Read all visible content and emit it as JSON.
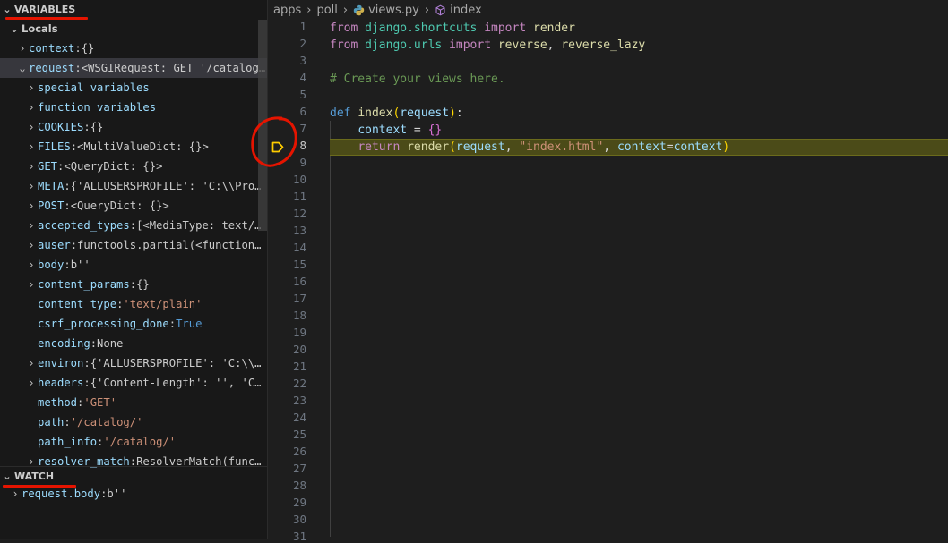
{
  "variables": {
    "title": "VARIABLES",
    "locals_label": "Locals",
    "items": [
      {
        "key": "context",
        "sep": ": ",
        "value": "{}",
        "vclass": "v",
        "kclass": "k2",
        "indent": 1,
        "chevron": "›"
      },
      {
        "key": "request",
        "sep": ": ",
        "value": "<WSGIRequest: GET '/catalog/'>",
        "vclass": "v",
        "kclass": "k2",
        "indent": 1,
        "chevron": "⌄",
        "selected": true
      },
      {
        "key": "special variables",
        "sep": "",
        "value": "",
        "vclass": "v",
        "kclass": "k2",
        "indent": 2,
        "chevron": "›"
      },
      {
        "key": "function variables",
        "sep": "",
        "value": "",
        "vclass": "v",
        "kclass": "k2",
        "indent": 2,
        "chevron": "›"
      },
      {
        "key": "COOKIES",
        "sep": ": ",
        "value": "{}",
        "vclass": "v",
        "kclass": "k2",
        "indent": 2,
        "chevron": "›"
      },
      {
        "key": "FILES",
        "sep": ": ",
        "value": "<MultiValueDict: {}>",
        "vclass": "v",
        "kclass": "k2",
        "indent": 2,
        "chevron": "›"
      },
      {
        "key": "GET",
        "sep": ": ",
        "value": "<QueryDict: {}>",
        "vclass": "v",
        "kclass": "k2",
        "indent": 2,
        "chevron": "›"
      },
      {
        "key": "META",
        "sep": ": ",
        "value": "{'ALLUSERSPROFILE': 'C:\\\\ProgramData'}",
        "vclass": "v",
        "kclass": "k2",
        "indent": 2,
        "chevron": "›"
      },
      {
        "key": "POST",
        "sep": ": ",
        "value": "<QueryDict: {}>",
        "vclass": "v",
        "kclass": "k2",
        "indent": 2,
        "chevron": "›"
      },
      {
        "key": "accepted_types",
        "sep": ": ",
        "value": "[<MediaType: text/plain>]",
        "vclass": "v",
        "kclass": "k2",
        "indent": 2,
        "chevron": "›"
      },
      {
        "key": "auser",
        "sep": ": ",
        "value": "functools.partial(<function auser>)",
        "vclass": "v",
        "kclass": "k2",
        "indent": 2,
        "chevron": "›"
      },
      {
        "key": "body",
        "sep": ": ",
        "value": "b''",
        "vclass": "v",
        "kclass": "k2",
        "indent": 2,
        "chevron": "›"
      },
      {
        "key": "content_params",
        "sep": ": ",
        "value": "{}",
        "vclass": "v",
        "kclass": "k2",
        "indent": 2,
        "chevron": "›"
      },
      {
        "key": "content_type",
        "sep": ": ",
        "value": "'text/plain'",
        "vclass": "vs",
        "kclass": "k2",
        "indent": 2,
        "chevron": ""
      },
      {
        "key": "csrf_processing_done",
        "sep": ": ",
        "value": "True",
        "vclass": "vb",
        "kclass": "k2",
        "indent": 2,
        "chevron": ""
      },
      {
        "key": "encoding",
        "sep": ": ",
        "value": "None",
        "vclass": "v",
        "kclass": "k2",
        "indent": 2,
        "chevron": ""
      },
      {
        "key": "environ",
        "sep": ": ",
        "value": "{'ALLUSERSPROFILE': 'C:\\\\ProgramData'}",
        "vclass": "v",
        "kclass": "k2",
        "indent": 2,
        "chevron": "›"
      },
      {
        "key": "headers",
        "sep": ": ",
        "value": "{'Content-Length': '', 'Content-Type'}",
        "vclass": "v",
        "kclass": "k2",
        "indent": 2,
        "chevron": "›"
      },
      {
        "key": "method",
        "sep": ": ",
        "value": "'GET'",
        "vclass": "vs",
        "kclass": "k2",
        "indent": 2,
        "chevron": ""
      },
      {
        "key": "path",
        "sep": ": ",
        "value": "'/catalog/'",
        "vclass": "vs",
        "kclass": "k2",
        "indent": 2,
        "chevron": ""
      },
      {
        "key": "path_info",
        "sep": ": ",
        "value": "'/catalog/'",
        "vclass": "vs",
        "kclass": "k2",
        "indent": 2,
        "chevron": ""
      },
      {
        "key": "resolver_match",
        "sep": ": ",
        "value": "ResolverMatch(func=apps.poll.views.index)",
        "vclass": "v",
        "kclass": "k2",
        "indent": 2,
        "chevron": "›"
      }
    ]
  },
  "watch": {
    "title": "WATCH",
    "items": [
      {
        "key": "request.body",
        "sep": ": ",
        "value": "b''",
        "vclass": "v",
        "kclass": "k2"
      }
    ]
  },
  "breadcrumb": {
    "parts": [
      "apps",
      "poll",
      "views.py",
      "index"
    ]
  },
  "editor": {
    "current_line": 8,
    "line_count": 31,
    "lines": [
      [
        {
          "t": "from ",
          "c": "kw"
        },
        {
          "t": "django.shortcuts ",
          "c": "mod"
        },
        {
          "t": "import ",
          "c": "kw"
        },
        {
          "t": "render",
          "c": "fn"
        }
      ],
      [
        {
          "t": "from ",
          "c": "kw"
        },
        {
          "t": "django.urls ",
          "c": "mod"
        },
        {
          "t": "import ",
          "c": "kw"
        },
        {
          "t": "reverse",
          "c": "fn"
        },
        {
          "t": ", ",
          "c": ""
        },
        {
          "t": "reverse_lazy",
          "c": "fn"
        }
      ],
      [],
      [
        {
          "t": "# Create your views here.",
          "c": "cmt"
        }
      ],
      [],
      [
        {
          "t": "def ",
          "c": "kwb"
        },
        {
          "t": "index",
          "c": "fn"
        },
        {
          "t": "(",
          "c": "br"
        },
        {
          "t": "request",
          "c": "par"
        },
        {
          "t": ")",
          "c": "br"
        },
        {
          "t": ":",
          "c": ""
        }
      ],
      [
        {
          "t": "    ",
          "c": ""
        },
        {
          "t": "context",
          "c": "par"
        },
        {
          "t": " = ",
          "c": ""
        },
        {
          "t": "{}",
          "c": "br2"
        }
      ],
      [
        {
          "t": "    ",
          "c": ""
        },
        {
          "t": "return ",
          "c": "kw"
        },
        {
          "t": "render",
          "c": "fn"
        },
        {
          "t": "(",
          "c": "br"
        },
        {
          "t": "request",
          "c": "par"
        },
        {
          "t": ", ",
          "c": ""
        },
        {
          "t": "\"index.html\"",
          "c": "str"
        },
        {
          "t": ", ",
          "c": ""
        },
        {
          "t": "context",
          "c": "par"
        },
        {
          "t": "=",
          "c": ""
        },
        {
          "t": "context",
          "c": "par"
        },
        {
          "t": ")",
          "c": "br"
        }
      ]
    ]
  },
  "colors": {
    "annotation": "#e51400",
    "debug_arrow": "#ffcc00"
  }
}
